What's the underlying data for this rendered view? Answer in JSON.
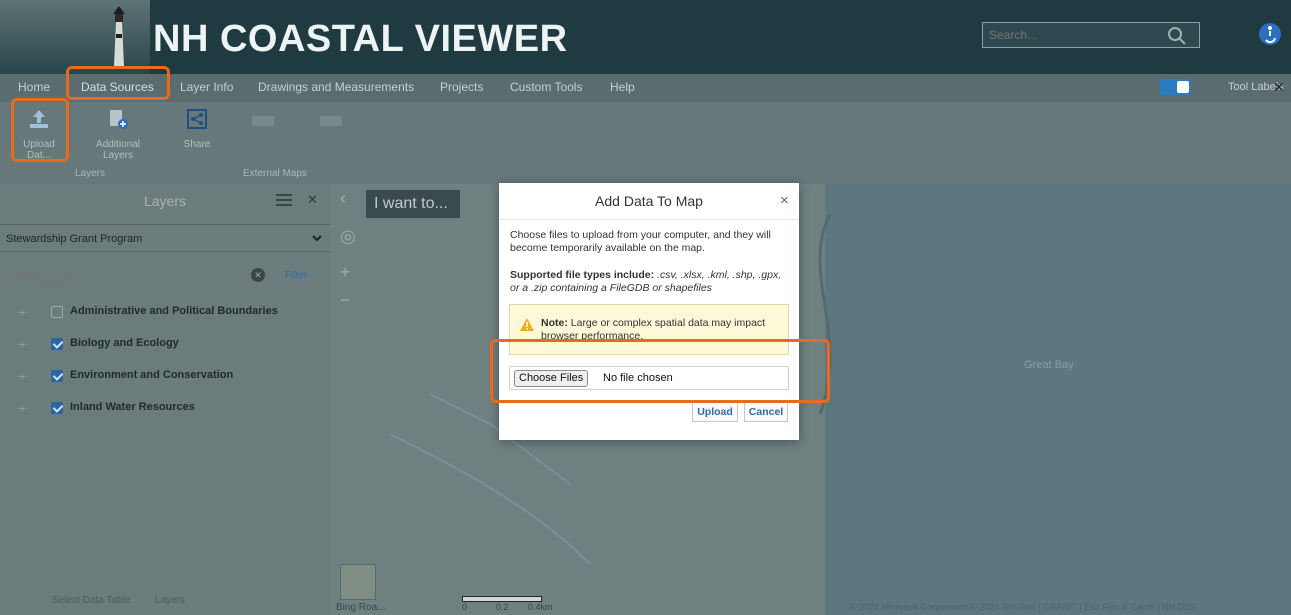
{
  "header": {
    "title": "NH COASTAL VIEWER",
    "search_placeholder": "Search..."
  },
  "nav": {
    "tabs": [
      "Home",
      "Data Sources",
      "Layer Info",
      "Drawings and Measurements",
      "Projects",
      "Custom Tools",
      "Help"
    ],
    "tool_labels": "Tool Labels",
    "close": "✕"
  },
  "toolbar": {
    "tools": [
      "Upload Dat...",
      "Additional Layers",
      "Share"
    ],
    "group_layers": "Layers",
    "group_external": "External Maps"
  },
  "layers_panel": {
    "title": "Layers",
    "close": "✕",
    "selected_program": "Stewardship Grant Program",
    "filter_placeholder": "Filter Layers...",
    "filter_button": "Filter",
    "items": [
      {
        "label": "Administrative and Political Boundaries",
        "checked": false
      },
      {
        "label": "Biology and Ecology",
        "checked": true
      },
      {
        "label": "Environment and Conservation",
        "checked": true
      },
      {
        "label": "Inland Water Resources",
        "checked": true
      }
    ],
    "footer": {
      "layers_tab": "Layers",
      "table_tab": "Select Data Table"
    }
  },
  "map": {
    "i_want_to": "I want to...",
    "bay_label": "Great Bay",
    "basemap_label": "Bing Roa...",
    "scale_labels": [
      "0",
      "0.2",
      "0.4km"
    ],
    "attribution": "© 2024 Microsoft Corporation © 2024 TomTom | GRANIT | Esri Fish & Game | NH DES"
  },
  "dialog": {
    "title": "Add Data To Map",
    "close": "×",
    "description": "Choose files to upload from your computer, and they will become temporarily available on the map.",
    "supported_label": "Supported file types include:",
    "supported_types": " .csv, .xlsx, .kml, .shp, .gpx, or a .zip containing a FileGDB or shapefiles",
    "warning_label": "Note:",
    "warning_text": " Large or complex spatial data may impact browser performance.",
    "choose_files": "Choose Files",
    "file_status": "No file chosen",
    "upload": "Upload",
    "cancel": "Cancel"
  },
  "colors": {
    "header_bg": "#1f3a40",
    "highlight": "#e86a1d",
    "accent_blue": "#2b6bb0"
  }
}
